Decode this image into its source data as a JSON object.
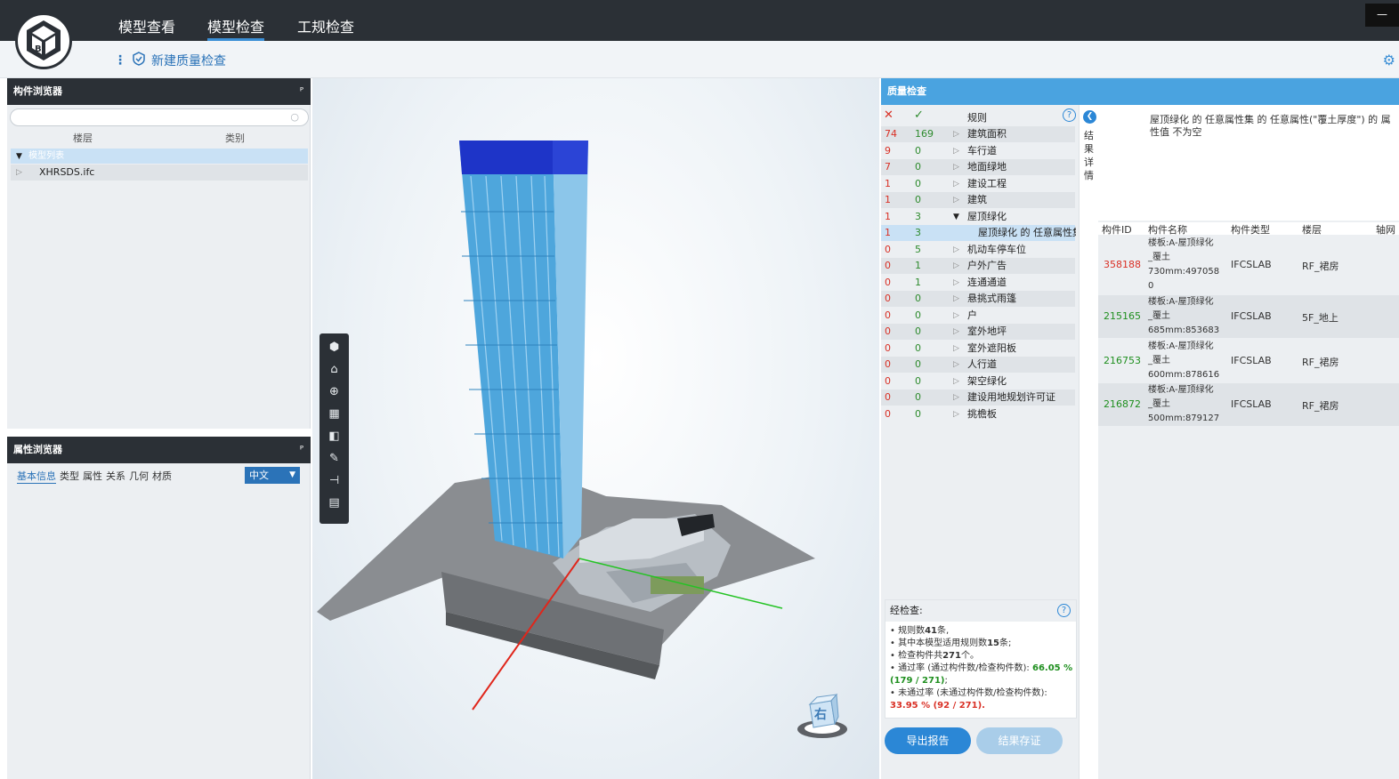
{
  "nav": {
    "tabs": [
      "模型查看",
      "模型检查",
      "工规检查"
    ],
    "active_tab": "模型检查",
    "minimize_label": "—"
  },
  "subbar": {
    "new_check_label": "新建质量检查"
  },
  "component_browser": {
    "title": "构件浏览器",
    "pin": "ᴾ",
    "search_placeholder": "",
    "columns": [
      "楼层",
      "类别"
    ],
    "tree_root": "模型列表",
    "tree_child": "XHRSDS.ifc"
  },
  "property_browser": {
    "title": "属性浏览器",
    "pin": "ᴾ",
    "tabs": [
      "基本信息",
      "类型",
      "属性",
      "关系",
      "几何",
      "材质"
    ],
    "language": "中文"
  },
  "viewcube_label": "右",
  "quality": {
    "title": "质量检查",
    "header_fail": "✕",
    "header_pass": "✓",
    "header_rule": "规则",
    "rules": [
      {
        "fail": "74",
        "pass": "169",
        "name": "建筑面积",
        "arrow": "▷"
      },
      {
        "fail": "9",
        "pass": "0",
        "name": "车行道",
        "arrow": "▷"
      },
      {
        "fail": "7",
        "pass": "0",
        "name": "地面绿地",
        "arrow": "▷"
      },
      {
        "fail": "1",
        "pass": "0",
        "name": "建设工程",
        "arrow": "▷"
      },
      {
        "fail": "1",
        "pass": "0",
        "name": "建筑",
        "arrow": "▷"
      },
      {
        "fail": "1",
        "pass": "3",
        "name": "屋顶绿化",
        "arrow": "▼"
      },
      {
        "fail": "1",
        "pass": "3",
        "name": "屋顶绿化 的 任意属性集",
        "arrow": ""
      },
      {
        "fail": "0",
        "pass": "5",
        "name": "机动车停车位",
        "arrow": "▷"
      },
      {
        "fail": "0",
        "pass": "1",
        "name": "户外广告",
        "arrow": "▷"
      },
      {
        "fail": "0",
        "pass": "1",
        "name": "连通通道",
        "arrow": "▷"
      },
      {
        "fail": "0",
        "pass": "0",
        "name": "悬挑式雨篷",
        "arrow": "▷"
      },
      {
        "fail": "0",
        "pass": "0",
        "name": "户",
        "arrow": "▷"
      },
      {
        "fail": "0",
        "pass": "0",
        "name": "室外地坪",
        "arrow": "▷"
      },
      {
        "fail": "0",
        "pass": "0",
        "name": "室外遮阳板",
        "arrow": "▷"
      },
      {
        "fail": "0",
        "pass": "0",
        "name": "人行道",
        "arrow": "▷"
      },
      {
        "fail": "0",
        "pass": "0",
        "name": "架空绿化",
        "arrow": "▷"
      },
      {
        "fail": "0",
        "pass": "0",
        "name": "建设用地规划许可证",
        "arrow": "▷"
      },
      {
        "fail": "0",
        "pass": "0",
        "name": "挑檐板",
        "arrow": "▷"
      }
    ],
    "summary": {
      "title": "经检查:",
      "line1_a": "• 规则数",
      "line1_b": "41",
      "line1_c": "条,",
      "line2_a": "• 其中本模型适用规则数",
      "line2_b": "15",
      "line2_c": "条;",
      "line3_a": "• 检查构件共",
      "line3_b": "271",
      "line3_c": "个。",
      "line4_a": "• 通过率 (通过构件数/检查构件数): ",
      "line4_b": "66.05 % (179 / 271)",
      "line4_c": ";",
      "line5_a": "• 未通过率 (未通过构件数/检查构件数):",
      "line5_b": "33.95 % (92 / 271)",
      "line5_c": "."
    },
    "export_label": "导出报告",
    "save_label": "结果存证",
    "side_tab_chars": [
      "结",
      "果",
      "详",
      "情"
    ],
    "rule_description": "屋顶绿化 的 任意属性集 的 任意属性(\"覆土厚度\") 的 属性值 不为空",
    "table_headers": [
      "构件ID",
      "构件名称",
      "构件类型",
      "楼层",
      "轴网"
    ],
    "results": [
      {
        "id": "358188",
        "id_color": "#d93025",
        "name": [
          "楼板:A-屋顶绿化",
          "_覆土",
          "730mm:497058",
          "0"
        ],
        "type": "IFCSLAB",
        "floor": "RF_裙房"
      },
      {
        "id": "215165",
        "id_color": "#1f8f1f",
        "name": [
          "楼板:A-屋顶绿化",
          "_覆土",
          "685mm:853683"
        ],
        "type": "IFCSLAB",
        "floor": "5F_地上"
      },
      {
        "id": "216753",
        "id_color": "#1f8f1f",
        "name": [
          "楼板:A-屋顶绿化",
          "_覆土",
          "600mm:878616"
        ],
        "type": "IFCSLAB",
        "floor": "RF_裙房"
      },
      {
        "id": "216872",
        "id_color": "#1f8f1f",
        "name": [
          "楼板:A-屋顶绿化",
          "_覆土",
          "500mm:879127"
        ],
        "type": "IFCSLAB",
        "floor": "RF_裙房"
      }
    ]
  }
}
